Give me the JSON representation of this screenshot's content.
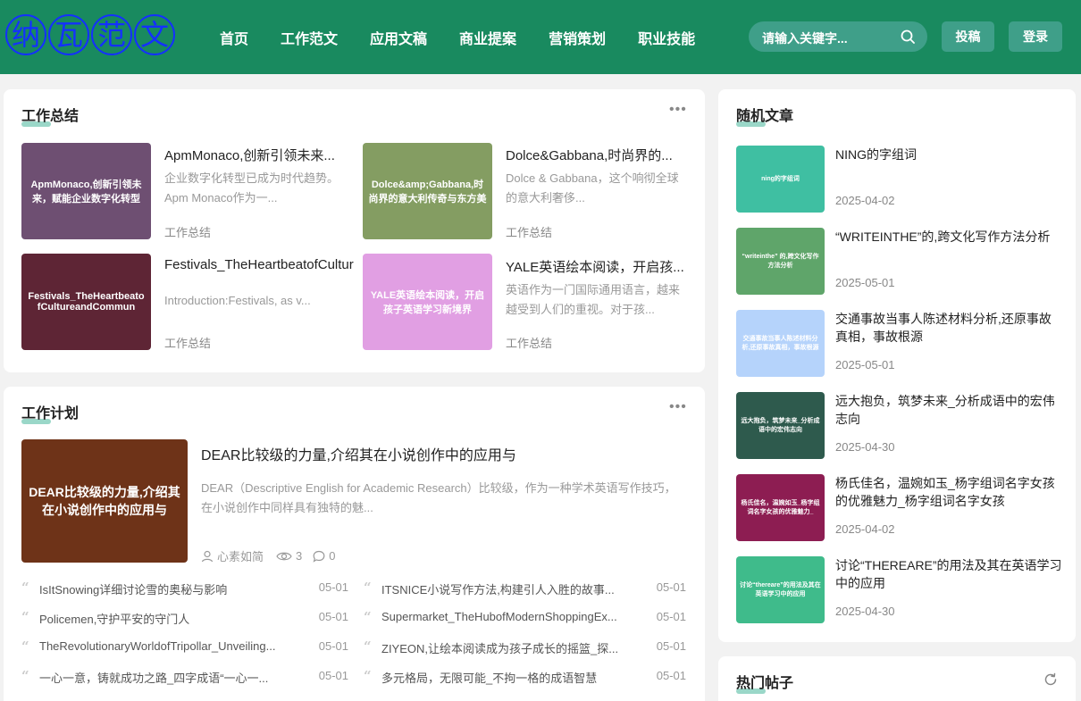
{
  "header": {
    "logo": [
      "纳",
      "瓦",
      "范",
      "文"
    ],
    "nav": [
      "首页",
      "工作范文",
      "应用文稿",
      "商业提案",
      "营销策划",
      "职业技能"
    ],
    "search_placeholder": "请输入关键字...",
    "submit_label": "投稿",
    "login_label": "登录"
  },
  "summary": {
    "title": "工作总结",
    "items": [
      {
        "thumb": "ApmMonaco,创新引领未来，赋能企业数字化转型",
        "thumb_color": "#6e4f72",
        "title": "ApmMonaco,创新引领未来...",
        "excerpt": "企业数字化转型已成为时代趋势。Apm Monaco作为一...",
        "category": "工作总结"
      },
      {
        "thumb": "Dolce&amp;Gabbana,时尚界的意大利传奇与东方美",
        "thumb_color": "#849d62",
        "title": "Dolce&Gabbana,时尚界的...",
        "excerpt": "Dolce & Gabbana，这个响彻全球的意大利奢侈...",
        "category": "工作总结"
      },
      {
        "thumb": "Festivals_TheHeartbeatofCultureandCommun",
        "thumb_color": "#5e2535",
        "title": "Festivals_TheHeartbeatofCultur",
        "excerpt": "Introduction:Festivals, as v...",
        "category": "工作总结"
      },
      {
        "thumb": "YALE英语绘本阅读，开启孩子英语学习新境界",
        "thumb_color": "#e19fe3",
        "title": "YALE英语绘本阅读，开启孩...",
        "excerpt": "英语作为一门国际通用语言，越来越受到人们的重视。对于孩...",
        "category": "工作总结"
      }
    ]
  },
  "plan": {
    "title": "工作计划",
    "featured": {
      "thumb": "DEAR比较级的力量,介绍其在小说创作中的应用与",
      "thumb_color": "#6e3318",
      "title": "DEAR比较级的力量,介绍其在小说创作中的应用与",
      "excerpt": "DEAR（Descriptive English for Academic Research）比较级，作为一种学术英语写作技巧，在小说创作中同样具有独特的魅...",
      "author": "心素如简",
      "views": "3",
      "comments": "0"
    },
    "list": [
      {
        "text": "IsItSnowing详细讨论雪的奥秘与影响",
        "date": "05-01"
      },
      {
        "text": "ITSNICE小说写作方法,构建引人入胜的故事...",
        "date": "05-01"
      },
      {
        "text": "Policemen,守护平安的守门人",
        "date": "05-01"
      },
      {
        "text": "Supermarket_TheHubofModernShoppingEx...",
        "date": "05-01"
      },
      {
        "text": "TheRevolutionaryWorldofTripollar_Unveiling...",
        "date": "05-01"
      },
      {
        "text": "ZIYEON,让绘本阅读成为孩子成长的摇篮_探...",
        "date": "05-01"
      },
      {
        "text": "一心一意，铸就成功之路_四字成语“一心一...",
        "date": "05-01"
      },
      {
        "text": "多元格局，无限可能_不拘一格的成语智慧",
        "date": "05-01"
      }
    ]
  },
  "random": {
    "title": "随机文章",
    "items": [
      {
        "thumb": "ning的字组词",
        "thumb_color": "#3fbfa2",
        "title": "NING的字组词",
        "date": "2025-04-02"
      },
      {
        "thumb": "“writeinthe” 的,跨文化写作方法分析",
        "thumb_color": "#5fa56a",
        "title": "“WRITEINTHE”的,跨文化写作方法分析",
        "date": "2025-05-01"
      },
      {
        "thumb": "交通事故当事人陈述材料分析,还原事故真相，事故根源",
        "thumb_color": "#b5d3fb",
        "title": "交通事故当事人陈述材料分析,还原事故真相，事故根源",
        "date": "2025-05-01"
      },
      {
        "thumb": "远大抱负，筑梦未来_分析成语中的宏伟志向",
        "thumb_color": "#2e5a4d",
        "title": "远大抱负，筑梦未来_分析成语中的宏伟志向",
        "date": "2025-04-30"
      },
      {
        "thumb": "杨氏佳名，温婉如玉_杨字组词名字女孩的优雅魅力_",
        "thumb_color": "#8d1d52",
        "title": "杨氏佳名，温婉如玉_杨字组词名字女孩的优雅魅力_杨字组词名字女孩",
        "date": "2025-04-02"
      },
      {
        "thumb": "讨论“thereare”的用法及其在英语学习中的应用",
        "thumb_color": "#3fbb8b",
        "title": "讨论“THEREARE”的用法及其在英语学习中的应用",
        "date": "2025-04-30"
      }
    ]
  },
  "hot": {
    "title": "热门帖子"
  }
}
